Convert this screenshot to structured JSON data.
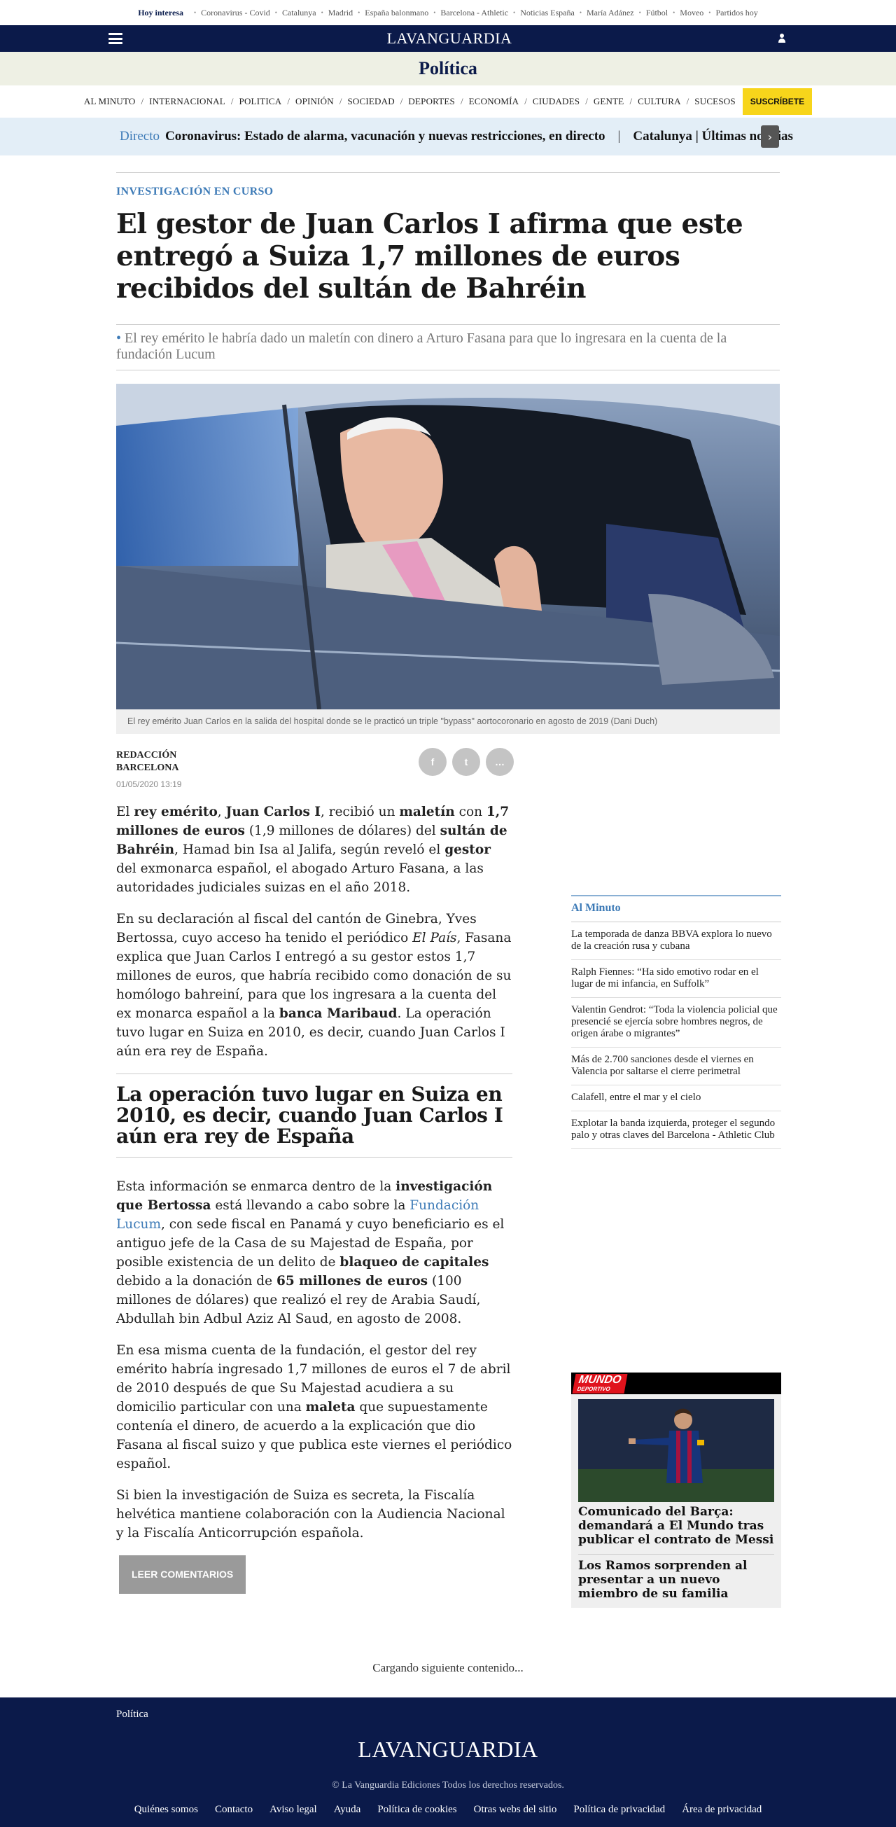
{
  "trending": {
    "title": "Hoy interesa",
    "items": [
      "Coronavirus - Covid",
      "Catalunya",
      "Madrid",
      "España balonmano",
      "Barcelona - Athletic",
      "Noticias España",
      "María Adánez",
      "Fútbol",
      "Moveo",
      "Partidos hoy"
    ]
  },
  "header": {
    "logo": "LAVANGUARDIA",
    "section": "Política"
  },
  "nav": {
    "items": [
      "AL MINUTO",
      "INTERNACIONAL",
      "POLITICA",
      "OPINIÓN",
      "SOCIEDAD",
      "DEPORTES",
      "ECONOMÍA",
      "CIUDADES",
      "GENTE",
      "CULTURA",
      "SUCESOS"
    ],
    "separator": "/",
    "subscribe": "SUSCRÍBETE"
  },
  "live": {
    "tag": "Directo",
    "text": "Coronavirus: Estado de alarma, vacunación y nuevas restricciones, en directo",
    "divider": "|",
    "text2": "Catalunya | Últimas noticias",
    "arrow": "›"
  },
  "article": {
    "kicker": "INVESTIGACIÓN EN CURSO",
    "headline": "El gestor de Juan Carlos I afirma que este entregó a Suiza 1,7 millones de euros recibidos del sultán de Bahréin",
    "bullet": "•",
    "subtitle": "El rey emérito le habría dado un maletín con dinero a Arturo Fasana para que lo ingresara en la cuenta de la fundación Lucum",
    "caption": "El rey emérito Juan Carlos en la salida del hospital donde se le practicó un triple \"bypass\" aortocoronario en agosto de 2019 (Dani Duch)",
    "byline1": "Redacción",
    "byline2": "Barcelona",
    "date": "01/05/2020 13:19",
    "share": {
      "facebook": "f",
      "twitter": "t",
      "comment": "…"
    },
    "p1": [
      {
        "t": "El ",
        "b": false
      },
      {
        "t": "rey emérito",
        "b": true
      },
      {
        "t": ", ",
        "b": false
      },
      {
        "t": "Juan Carlos I",
        "b": true
      },
      {
        "t": ", recibió un ",
        "b": false
      },
      {
        "t": "maletín",
        "b": true
      },
      {
        "t": " con ",
        "b": false
      },
      {
        "t": "1,7 millones de euros",
        "b": true
      },
      {
        "t": " (1,9 millones de dólares) del ",
        "b": false
      },
      {
        "t": "sultán de Bahréin",
        "b": true
      },
      {
        "t": ", Hamad bin Isa al Jalifa, según reveló el ",
        "b": false
      },
      {
        "t": "gestor",
        "b": true
      },
      {
        "t": " del exmonarca español, el abogado Arturo Fasana, a las autoridades judiciales suizas en el año 2018.",
        "b": false
      }
    ],
    "p2": [
      {
        "t": "En su declaración al fiscal del cantón de Ginebra, Yves Bertossa, cuyo acceso ha tenido el periódico ",
        "b": false
      },
      {
        "t": "El País",
        "i": true
      },
      {
        "t": ", Fasana explica que Juan Carlos I entregó a su gestor estos 1,7 millones de euros, que habría recibido como donación de su homólogo bahreiní, para que los ingresara a la cuenta del ex monarca español a la ",
        "b": false
      },
      {
        "t": "banca Maribaud",
        "b": true
      },
      {
        "t": ". La operación tuvo lugar en Suiza en 2010, es decir, cuando Juan Carlos I aún era rey de España.",
        "b": false
      }
    ],
    "pull": "La operación tuvo lugar en Suiza en 2010, es decir, cuando Juan Carlos I aún era rey de España",
    "p3": [
      {
        "t": "Esta información se enmarca dentro de la ",
        "b": false
      },
      {
        "t": "investigación que Bertossa",
        "b": true
      },
      {
        "t": " está llevando a cabo sobre la ",
        "b": false
      },
      {
        "t": "Fundación Lucum",
        "link": true
      },
      {
        "t": ", con sede fiscal en Panamá y cuyo beneficiario es el antiguo jefe de la Casa de su Majestad de España, por posible existencia de un delito de ",
        "b": false
      },
      {
        "t": "blaqueo de capitales",
        "b": true
      },
      {
        "t": " debido a la donación de ",
        "b": false
      },
      {
        "t": "65 millones de euros",
        "b": true
      },
      {
        "t": " (100 millones de dólares) que realizó el rey de Arabia Saudí, Abdullah bin Adbul Aziz Al Saud, en agosto de 2008.",
        "b": false
      }
    ],
    "p4": [
      {
        "t": "En esa misma cuenta de la fundación, el gestor del rey emérito habría ingresado 1,7 millones de euros el 7 de abril de 2010 después de que Su Majestad acudiera a su domicilio particular con una ",
        "b": false
      },
      {
        "t": "maleta",
        "b": true
      },
      {
        "t": " que supuestamente contenía el dinero, de acuerdo a la explicación que dio Fasana al fiscal suizo y que publica este viernes el periódico español.",
        "b": false
      }
    ],
    "p5": "Si bien la investigación de Suiza es secreta, la Fiscalía helvética mantiene colaboración con la Audiencia Nacional y la Fiscalía Anticorrupción española.",
    "comments": "LEER COMENTARIOS"
  },
  "sidebar": {
    "title": "Al Minuto",
    "items": [
      "La temporada de danza BBVA explora lo nuevo de la creación rusa y cubana",
      "Ralph Fiennes: “Ha sido emotivo rodar en el lugar de mi infancia, en Suffolk”",
      "Valentin Gendrot: “Toda la violencia policial que presencié se ejercía sobre hombres negros, de origen árabe o migrantes”",
      "Más de 2.700 sanciones desde el viernes en Valencia por saltarse el cierre perimetral",
      "Calafell, entre el mar y el cielo",
      "Explotar la banda izquierda, proteger el segundo palo y otras claves del Barcelona - Athletic Club"
    ]
  },
  "promo": {
    "logo_top": "MUNDO",
    "logo_bottom": "DEPORTIVO",
    "title1": "Comunicado del Barça: demandará a El Mundo tras publicar el contrato de Messi",
    "title2": "Los Ramos sorprenden al presentar a un nuevo miembro de su familia"
  },
  "loading": "Cargando siguiente contenido...",
  "footer": {
    "section": "Política",
    "logo": "LAVANGUARDIA",
    "copyright": "© La Vanguardia Ediciones Todos los derechos reservados.",
    "links": [
      "Quiénes somos",
      "Contacto",
      "Aviso legal",
      "Ayuda",
      "Política de cookies",
      "Otras webs del sitio",
      "Política de privacidad",
      "Área de privacidad"
    ]
  },
  "colors": {
    "navy": "#0b1a4a",
    "accent_blue": "#3e7bb7",
    "subscribe_yellow": "#f7d51b",
    "mundo_red": "#e0131c"
  }
}
